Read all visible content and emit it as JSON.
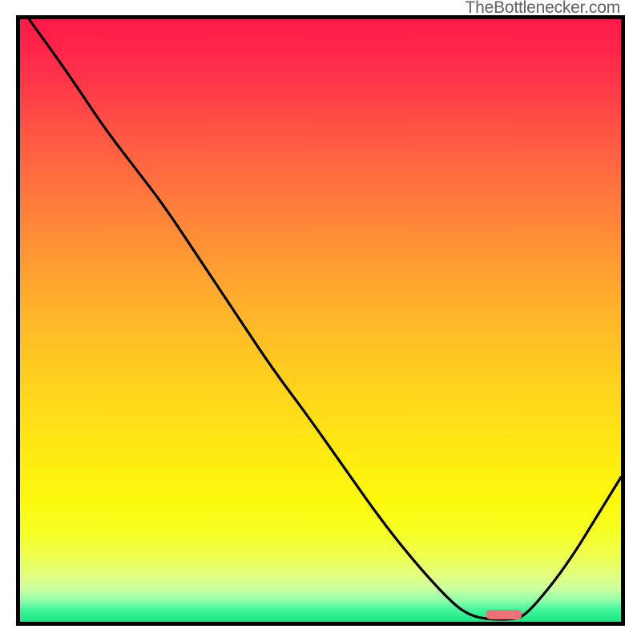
{
  "watermark": "TheBottlenecker.com",
  "colors": {
    "frame": "#000000",
    "curve": "#000000",
    "marker_fill": "#eb7277",
    "gradient_stops": [
      {
        "offset": 0.0,
        "color": "#ff1a49"
      },
      {
        "offset": 0.05,
        "color": "#ff254a"
      },
      {
        "offset": 0.1,
        "color": "#ff3449"
      },
      {
        "offset": 0.17,
        "color": "#ff4f45"
      },
      {
        "offset": 0.25,
        "color": "#ff6a40"
      },
      {
        "offset": 0.33,
        "color": "#ff8439"
      },
      {
        "offset": 0.42,
        "color": "#ffa031"
      },
      {
        "offset": 0.5,
        "color": "#ffb729"
      },
      {
        "offset": 0.58,
        "color": "#ffcc20"
      },
      {
        "offset": 0.66,
        "color": "#ffde18"
      },
      {
        "offset": 0.73,
        "color": "#ffec10"
      },
      {
        "offset": 0.8,
        "color": "#fcf90c"
      },
      {
        "offset": 0.85,
        "color": "#f6ff23"
      },
      {
        "offset": 0.89,
        "color": "#eeff4e"
      },
      {
        "offset": 0.92,
        "color": "#e4ff7a"
      },
      {
        "offset": 0.945,
        "color": "#cbffa0"
      },
      {
        "offset": 0.965,
        "color": "#8effac"
      },
      {
        "offset": 0.98,
        "color": "#42f59a"
      },
      {
        "offset": 1.0,
        "color": "#18e986"
      }
    ]
  },
  "chart_data": {
    "type": "line",
    "title": "",
    "xlabel": "",
    "ylabel": "",
    "xlim": [
      0,
      100
    ],
    "ylim": [
      0,
      100
    ],
    "note": "Axes unlabeled; values estimated from pixel positions normalized 0–100. y=0 is bottom, y=100 is top of plot.",
    "series": [
      {
        "name": "bottleneck-curve",
        "x": [
          1.5,
          8,
          14,
          19,
          24,
          30,
          36,
          42,
          48,
          54,
          60,
          66,
          72,
          75,
          78,
          82,
          84,
          88,
          92,
          96,
          100
        ],
        "y": [
          100,
          91,
          82,
          75.5,
          69,
          60,
          51,
          42,
          34,
          25.5,
          17,
          9.5,
          3,
          1,
          0.4,
          0.4,
          1,
          5.5,
          11,
          17.5,
          24
        ]
      }
    ],
    "marker": {
      "name": "optimal-range",
      "shape": "rounded-bar",
      "x_start": 77.5,
      "x_end": 83.5,
      "y": 1.2
    }
  }
}
